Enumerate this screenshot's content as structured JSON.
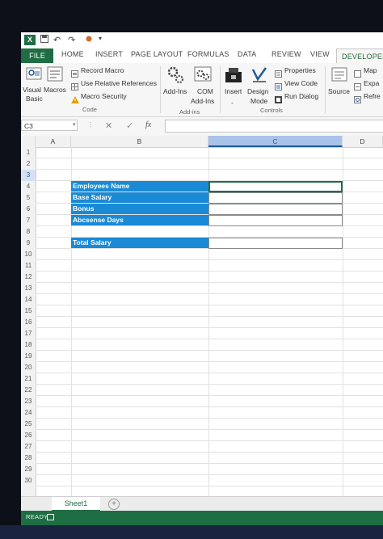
{
  "quick_access": {
    "app_icon": "X",
    "save": "save-icon",
    "undo": "↶",
    "redo": "↷"
  },
  "tabs": [
    "FILE",
    "HOME",
    "INSERT",
    "PAGE LAYOUT",
    "FORMULAS",
    "DATA",
    "REVIEW",
    "VIEW",
    "DEVELOPER"
  ],
  "ribbon": {
    "code": {
      "visual_basic": [
        "Visual",
        "Basic"
      ],
      "macros": "Macros",
      "record_macro": "Record Macro",
      "relative_refs": "Use Relative References",
      "macro_security": "Macro Security",
      "label": "Code"
    },
    "addins": {
      "addins": "Add-Ins",
      "com": [
        "COM",
        "Add-Ins"
      ],
      "label": "Add-ins"
    },
    "controls": {
      "insert": "Insert",
      "insert_arrow": "-",
      "design": [
        "Design",
        "Mode"
      ],
      "properties": "Properties",
      "view_code": "View Code",
      "run_dialog": "Run Dialog",
      "label": "Controls"
    },
    "xml": {
      "source": "Source",
      "map": "Map",
      "expand": "Expa",
      "refresh": "Refre"
    }
  },
  "formula_bar": {
    "name_box": "C3",
    "cancel": "✕",
    "enter": "✓",
    "fx": "fx",
    "value": ""
  },
  "columns": [
    "A",
    "B",
    "C",
    "D"
  ],
  "rows": [
    "1",
    "2",
    "3",
    "4",
    "5",
    "6",
    "7",
    "8",
    "9",
    "10",
    "11",
    "12",
    "13",
    "14",
    "15",
    "16",
    "17",
    "18",
    "19",
    "20",
    "21",
    "22",
    "23",
    "24",
    "25",
    "26",
    "27",
    "28",
    "29",
    "30"
  ],
  "cells": {
    "b3": "Employees Name",
    "b4": "Base Salary",
    "b5": "Bonus",
    "b6": "Abcsense Days",
    "b8": "Total Salary"
  },
  "sheets": [
    "Sheet1"
  ],
  "add_sheet": "+",
  "status": {
    "mode": "READY"
  },
  "colors": {
    "excel_green": "#1f6e43",
    "cell_blue": "#1a8ad6",
    "selected_header": "#a9c3e8"
  }
}
